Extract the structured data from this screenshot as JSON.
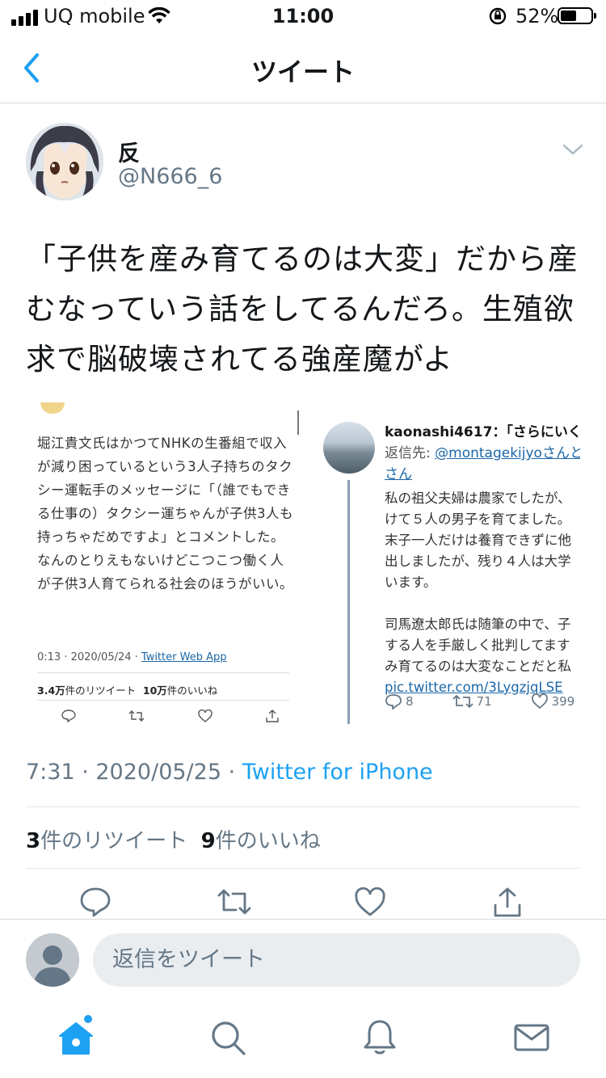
{
  "status_bar": {
    "carrier": "UQ mobile",
    "time": "11:00",
    "battery_percent": "52%",
    "battery_level": 0.52
  },
  "nav": {
    "title": "ツイート"
  },
  "tweet": {
    "display_name": "反",
    "handle": "@N666_6",
    "text": "「子供を産み育てるのは大変」だから産むなっていう話をしてるんだろ。生殖欲求で脳破壊されてる強産魔がよ",
    "timestamp": "7:31 · 2020/05/25 · ",
    "source": "Twitter for iPhone",
    "retweet_count": "3",
    "retweet_label": "件のリツイート",
    "like_count": "9",
    "like_label": "件のいいね"
  },
  "media": {
    "left": {
      "text": "堀江貴文氏はかつてNHKの生番組で収入が減り困っているという3人子持ちのタクシー運転手のメッセージに「（誰でもできる仕事の）タクシー運ちゃんが子供3人も持っちゃだめですよ」とコメントした。なんのとりえもないけどこつこつ働く人が子供3人育てられる社会のほうがいい。",
      "meta_time": "0:13 · 2020/05/24 · ",
      "meta_source": "Twitter Web App",
      "retweets": "3.4万",
      "retweets_label": "件のリツイート",
      "likes": "10万",
      "likes_label": "件のいいね"
    },
    "right": {
      "name": "kaonashi4617：「さらにいく",
      "reply_prefix": "返信先: ",
      "reply_to": "@montagekijyoさんと",
      "reply_suffix": "さん",
      "body": "私の祖父夫婦は農家でしたが、\nけて５人の男子を育てました。\n末子一人だけは養育できずに他\n出しましたが、残り４人は大学\nいます。\n\n司馬遼太郎氏は随筆の中で、子\nする人を手厳しく批判してます\nみ育てるのは大変なことだと私",
      "pic_link": "pic.twitter.com/3LygzjqLSE",
      "reply_count": "8",
      "retweet_count": "71",
      "like_count": "399"
    }
  },
  "composer": {
    "placeholder": "返信をツイート"
  },
  "colors": {
    "accent": "#1da1f2",
    "secondary_text": "#657786",
    "divider": "#e1e8ed"
  }
}
